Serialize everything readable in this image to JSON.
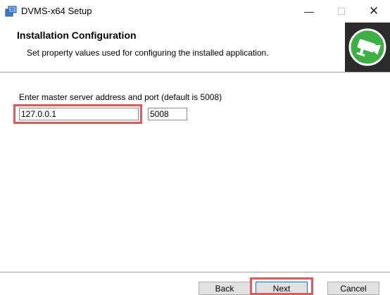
{
  "window": {
    "title": "DVMS-x64 Setup",
    "minimize_glyph": "—",
    "maximize_glyph": "☐",
    "close_glyph": "✕"
  },
  "banner": {
    "title": "Installation Configuration",
    "subtitle": "Set property values used for configuring the installed application.",
    "logo_icon": "security-camera-icon"
  },
  "form": {
    "prompt": "Enter master server address and port (default is 5008)",
    "server_address": "127.0.0.1",
    "port": "5008"
  },
  "buttons": {
    "back": "Back",
    "next": "Next",
    "cancel": "Cancel"
  },
  "colors": {
    "highlight": "#e05a5a",
    "logo_green": "#3cb043",
    "logo_bg": "#2b2b2b"
  }
}
